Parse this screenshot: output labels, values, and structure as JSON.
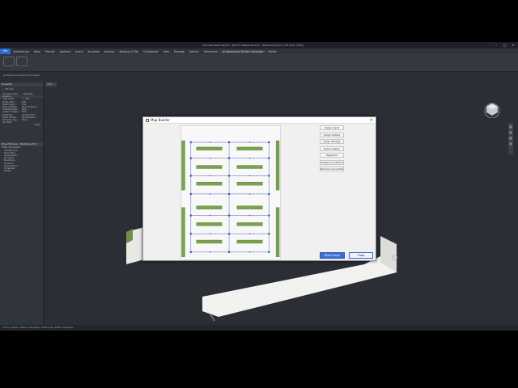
{
  "window": {
    "title": "Autodesk Revit 2024.2 - Not For Resale Version - [Warehouse_Ex4 | 3D View: {3D}]",
    "menu": [
      "File",
      "Architecture",
      "Steel",
      "Precast",
      "Systems",
      "Insert",
      "Annotate",
      "Analyze",
      "Massing & Site",
      "Collaborate",
      "View",
      "Manage",
      "Add-Ins",
      "Omniverse",
      "AI Warehouse Builder Simulator",
      "Modify"
    ],
    "active_menu": "AI Warehouse Builder Simulator",
    "ribbon_group": "AI Warehouse Robot Simulator"
  },
  "properties": {
    "header": "Properties",
    "type": "3D View",
    "selector": "3D View: {3D}",
    "edit_type": "Edit Type",
    "section": "Graphics",
    "rows": [
      {
        "k": "View Scale",
        "v": "1 : 100"
      },
      {
        "k": "Scale Value",
        "v": "100"
      },
      {
        "k": "Detail Level",
        "v": "Fine"
      },
      {
        "k": "Parts Visibility",
        "v": "Show Original"
      },
      {
        "k": "Visibility/Grap...",
        "v": "Edit..."
      },
      {
        "k": "Graphic Displa...",
        "v": "Edit..."
      },
      {
        "k": "Discipline",
        "v": "Coordination"
      },
      {
        "k": "Show Hidden ...",
        "v": "By Discipline"
      },
      {
        "k": "Default Analy...",
        "v": "None"
      },
      {
        "k": "Sun Path",
        "v": ""
      }
    ],
    "apply": "Apply"
  },
  "browser": {
    "header": "Project Browser - Warehouse_Ex4",
    "items": [
      "Views (Discipline)",
      "Architectural",
      "Floor Plans",
      "Ceiling Plans",
      "3D Views",
      "Elevations",
      "Sections",
      "Coordination",
      "Schedules",
      "Sheets"
    ]
  },
  "view_tab": "{3D}",
  "status": "Click to select, TAB for alternates, CTRL adds, SHIFT unselects.",
  "dialog": {
    "title": "Map Builder",
    "side_buttons": [
      "Cargo Input",
      "Cargo Output",
      "Cargo Storage",
      "Robot Spawn",
      "Waypoint",
      "Create Connection",
      "Remove Connection"
    ],
    "build": "Build Graph",
    "close": "Close"
  }
}
